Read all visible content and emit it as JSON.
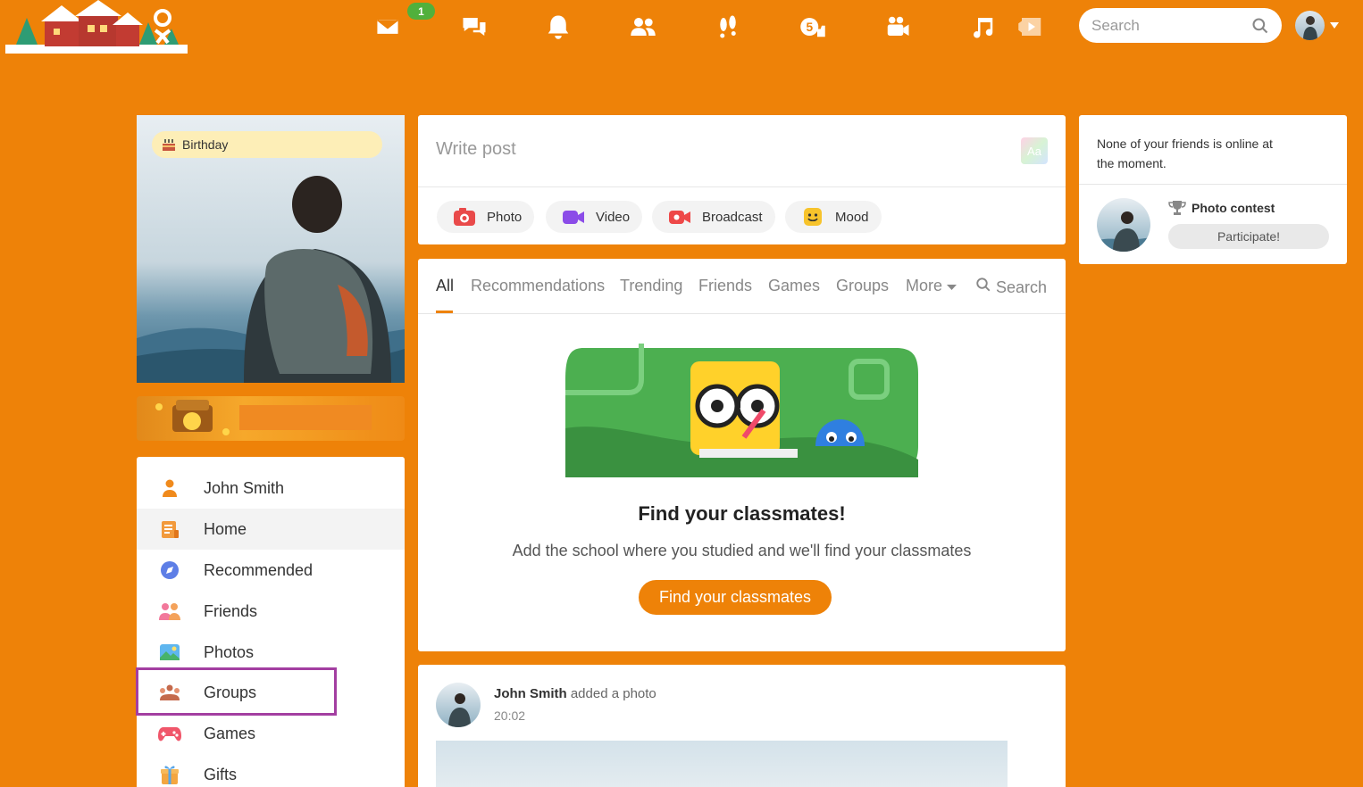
{
  "topbar": {
    "message_badge": "1",
    "nav_icons": [
      "envelope-icon",
      "chat-icon",
      "bell-icon",
      "friends-icon",
      "footprints-icon",
      "five-like-icon",
      "video-camera-icon",
      "music-icon",
      "play-video-icon"
    ],
    "search_placeholder": "Search"
  },
  "profile": {
    "birthday_label": "Birthday"
  },
  "sidebar": {
    "items": [
      {
        "label": "John Smith",
        "icon": "user-icon"
      },
      {
        "label": "Home",
        "icon": "home-feed-icon",
        "active": true
      },
      {
        "label": "Recommended",
        "icon": "compass-icon"
      },
      {
        "label": "Friends",
        "icon": "friends-icon"
      },
      {
        "label": "Photos",
        "icon": "photos-icon"
      },
      {
        "label": "Groups",
        "icon": "groups-icon",
        "highlighted": true
      },
      {
        "label": "Games",
        "icon": "gamepad-icon"
      },
      {
        "label": "Gifts",
        "icon": "gift-icon"
      }
    ]
  },
  "post_box": {
    "placeholder": "Write post",
    "font_button": "Aa",
    "actions": [
      {
        "label": "Photo",
        "icon": "camera-icon"
      },
      {
        "label": "Video",
        "icon": "video-icon"
      },
      {
        "label": "Broadcast",
        "icon": "broadcast-icon"
      },
      {
        "label": "Mood",
        "icon": "smiley-icon"
      }
    ]
  },
  "feed": {
    "tabs": [
      "All",
      "Recommendations",
      "Trending",
      "Friends",
      "Games",
      "Groups",
      "More"
    ],
    "search_label": "Search",
    "active_tab": "All",
    "classmates": {
      "title": "Find your classmates!",
      "subtitle": "Add the school where you studied and we'll find your classmates",
      "button": "Find your classmates"
    }
  },
  "activity": {
    "author": "John Smith",
    "action": "added a photo",
    "time": "20:02"
  },
  "right": {
    "online_text": "None of your friends is online at the moment.",
    "contest_title": "Photo contest",
    "participate_button": "Participate!"
  },
  "colors": {
    "brand_orange": "#ee8208",
    "badge_green": "#51b03c",
    "highlight_purple": "#a33ea1"
  }
}
